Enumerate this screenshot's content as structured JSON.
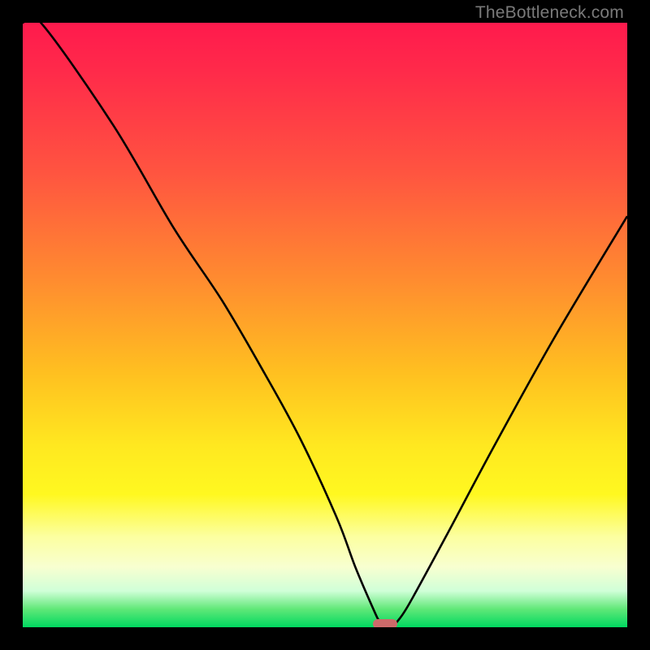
{
  "watermark": "TheBottleneck.com",
  "colors": {
    "frame": "#000000",
    "curve_stroke": "#000000",
    "marker_fill": "#cc6a6a",
    "gradient_top": "#ff1a4d",
    "gradient_bottom": "#00d860"
  },
  "chart_data": {
    "type": "line",
    "title": "",
    "xlabel": "",
    "ylabel": "",
    "xlim": [
      0,
      100
    ],
    "ylim": [
      0,
      100
    ],
    "x": [
      0,
      3,
      15,
      25,
      33,
      40,
      46,
      52,
      55,
      58,
      59,
      60,
      61,
      62,
      64,
      70,
      78,
      88,
      100
    ],
    "values": [
      100,
      100,
      83,
      66,
      54,
      42,
      31,
      18,
      10,
      3,
      1,
      0,
      0,
      1,
      4,
      15,
      30,
      48,
      68
    ],
    "minimum_marker": {
      "x": 60,
      "y": 0
    },
    "annotations": []
  }
}
